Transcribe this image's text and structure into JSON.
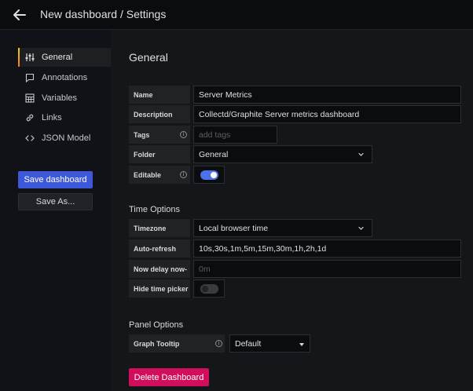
{
  "header": {
    "title": "New dashboard / Settings"
  },
  "sidebar": {
    "items": [
      {
        "label": "General",
        "icon": "sliders-icon",
        "active": true
      },
      {
        "label": "Annotations",
        "icon": "comment-icon"
      },
      {
        "label": "Variables",
        "icon": "calculator-icon"
      },
      {
        "label": "Links",
        "icon": "link-icon"
      },
      {
        "label": "JSON Model",
        "icon": "code-icon"
      }
    ],
    "save_label": "Save dashboard",
    "save_as_label": "Save As..."
  },
  "general": {
    "heading": "General",
    "name_label": "Name",
    "name_value": "Server Metrics",
    "description_label": "Description",
    "description_value": "Collectd/Graphite Server metrics dashboard",
    "tags_label": "Tags",
    "tags_placeholder": "add tags",
    "folder_label": "Folder",
    "folder_value": "General",
    "editable_label": "Editable",
    "editable_on": true
  },
  "time_options": {
    "title": "Time Options",
    "timezone_label": "Timezone",
    "timezone_value": "Local browser time",
    "autorefresh_label": "Auto-refresh",
    "autorefresh_value": "10s,30s,1m,5m,15m,30m,1h,2h,1d",
    "nowdelay_label": "Now delay now-",
    "nowdelay_placeholder": "0m",
    "hidepicker_label": "Hide time picker",
    "hidepicker_on": false
  },
  "panel_options": {
    "title": "Panel Options",
    "tooltip_label": "Graph Tooltip",
    "tooltip_value": "Default"
  },
  "actions": {
    "delete_label": "Delete Dashboard"
  },
  "colors": {
    "primary": "#3d59da",
    "danger": "#d10e5c",
    "toggle_on": "#4d71e6",
    "accent_gradient": "#f2cc0c"
  }
}
